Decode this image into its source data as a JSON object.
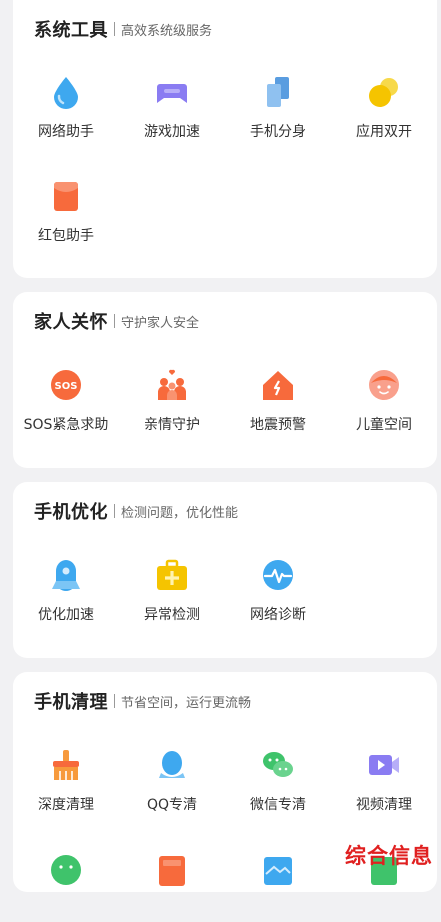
{
  "sections": [
    {
      "title": "系统工具",
      "subtitle": "高效系统级服务",
      "items": [
        {
          "label": "网络助手",
          "icon": "water-drop-icon"
        },
        {
          "label": "游戏加速",
          "icon": "gamepad-icon"
        },
        {
          "label": "手机分身",
          "icon": "dual-phone-icon"
        },
        {
          "label": "应用双开",
          "icon": "dual-app-icon"
        },
        {
          "label": "红包助手",
          "icon": "red-envelope-icon"
        }
      ]
    },
    {
      "title": "家人关怀",
      "subtitle": "守护家人安全",
      "items": [
        {
          "label": "SOS紧急求助",
          "icon": "sos-icon"
        },
        {
          "label": "亲情守护",
          "icon": "family-icon"
        },
        {
          "label": "地震预警",
          "icon": "earthquake-icon"
        },
        {
          "label": "儿童空间",
          "icon": "child-face-icon"
        }
      ]
    },
    {
      "title": "手机优化",
      "subtitle": "检测问题，优化性能",
      "items": [
        {
          "label": "优化加速",
          "icon": "rocket-icon"
        },
        {
          "label": "异常检测",
          "icon": "medical-kit-icon"
        },
        {
          "label": "网络诊断",
          "icon": "network-pulse-icon"
        }
      ]
    },
    {
      "title": "手机清理",
      "subtitle": "节省空间，运行更流畅",
      "items": [
        {
          "label": "深度清理",
          "icon": "broom-icon"
        },
        {
          "label": "QQ专清",
          "icon": "qq-icon"
        },
        {
          "label": "微信专清",
          "icon": "wechat-icon"
        },
        {
          "label": "视频清理",
          "icon": "video-icon"
        }
      ]
    }
  ],
  "watermark": "综合信息",
  "colors": {
    "blue": "#3ea8ef",
    "purple": "#8a7cf2",
    "yellow": "#f5c400",
    "orange": "#f76a3c",
    "green": "#3fc36b",
    "red": "#e02020"
  }
}
